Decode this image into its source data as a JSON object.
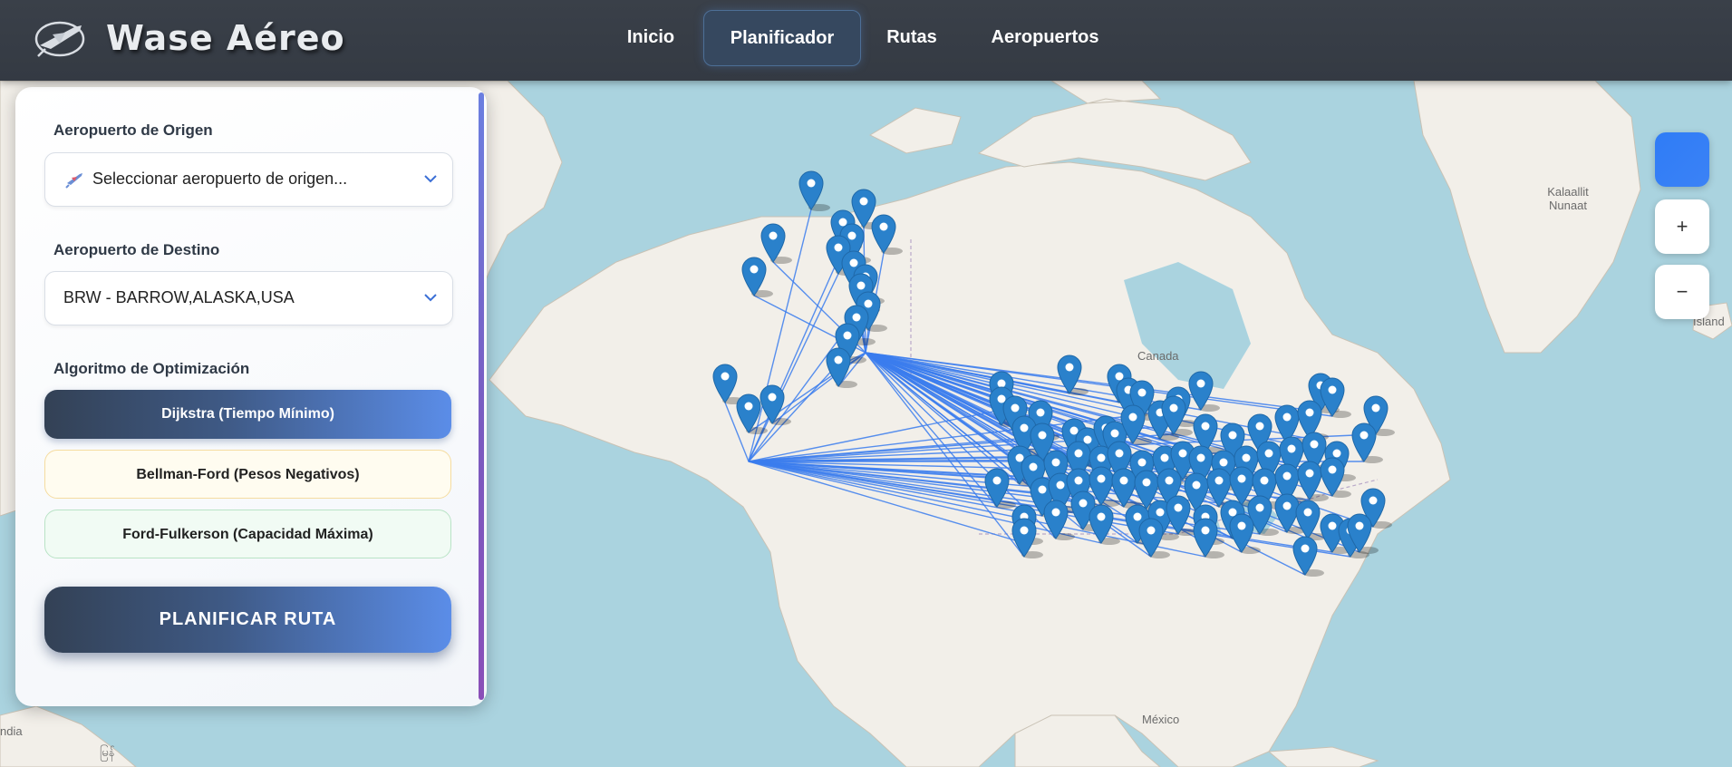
{
  "app": {
    "name": "Wase Aéreo"
  },
  "nav": [
    {
      "label": "Inicio",
      "active": false
    },
    {
      "label": "Planificador",
      "active": true
    },
    {
      "label": "Rutas",
      "active": false
    },
    {
      "label": "Aeropuertos",
      "active": false
    }
  ],
  "form": {
    "origin": {
      "label": "Aeropuerto de Origen",
      "placeholder": "Seleccionar aeropuerto de origen...",
      "value": ""
    },
    "destination": {
      "label": "Aeropuerto de Destino",
      "value": "BRW - BARROW,ALASKA,USA"
    },
    "algorithm": {
      "label": "Algoritmo de Optimización",
      "options": [
        {
          "label": "Dijkstra (Tiempo Mínimo)",
          "selected": true
        },
        {
          "label": "Bellman-Ford (Pesos Negativos)",
          "selected": false
        },
        {
          "label": "Ford-Fulkerson (Capacidad Máxima)",
          "selected": false
        }
      ]
    },
    "submit_label": "PLANIFICAR RUTA"
  },
  "map": {
    "labels": {
      "greenland": "Kalaallit\nNunaat",
      "canada": "Canada",
      "mexico": "México",
      "iceland": "Island",
      "india_fragment": "ndia",
      "myanmar_fragment": "မြန်"
    },
    "zoom_in": "+",
    "zoom_out": "−"
  },
  "colors": {
    "header_bg": "#373d45",
    "water": "#aad3df",
    "land": "#f2efe9",
    "route": "#3b7ded",
    "marker": "#2a81cb",
    "accent": "#5b8de8"
  }
}
